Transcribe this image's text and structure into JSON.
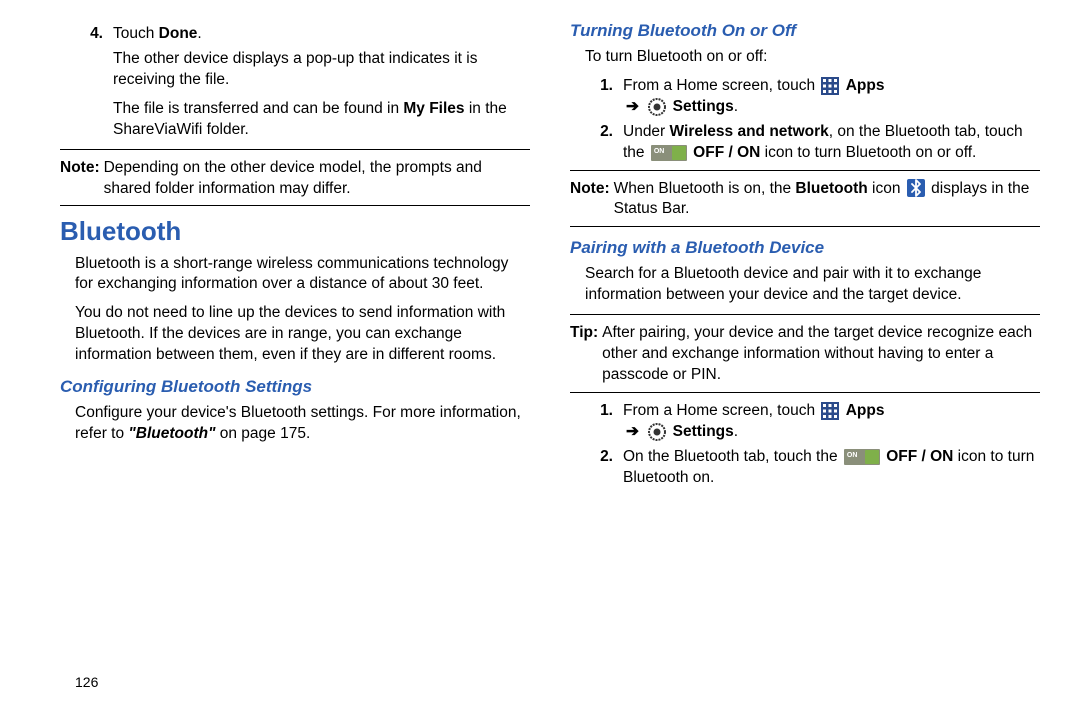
{
  "left": {
    "step4_num": "4.",
    "step4_a": "Touch ",
    "step4_b": "Done",
    "step4_c": ".",
    "step4_p1": "The other device displays a pop-up that indicates it is receiving the file.",
    "step4_p2a": "The file is transferred and can be found in ",
    "step4_p2b": "My Files",
    "step4_p2c": " in the ShareViaWifi folder.",
    "note_label": "Note:",
    "note_body": "Depending on the other device model, the prompts and shared folder information may differ.",
    "h1": "Bluetooth",
    "bt_p1": "Bluetooth is a short-range wireless communications technology for exchanging information over a distance of about 30 feet.",
    "bt_p2": "You do not need to line up the devices to send information with Bluetooth. If the devices are in range, you can exchange information between them, even if they are in different rooms.",
    "h2_cfg": "Configuring Bluetooth Settings",
    "cfg_p_a": "Configure your device's Bluetooth settings. For more information, refer to ",
    "cfg_p_b": "\"Bluetooth\" ",
    "cfg_p_c": " on page 175.",
    "pagenum": "126"
  },
  "right": {
    "h2_turn": "Turning Bluetooth On or Off",
    "turn_intro": "To turn Bluetooth on or off:",
    "s1_num": "1.",
    "s1_a": "From a Home screen, touch ",
    "s1_b": " Apps",
    "s1_c": " Settings",
    "s1_d": ".",
    "s2_num": "2.",
    "s2_a": "Under ",
    "s2_b": "Wireless and network",
    "s2_c": ", on the Bluetooth tab, touch the ",
    "s2_d": " OFF / ON",
    "s2_e": " icon to turn Bluetooth on or off.",
    "note_label": "Note:",
    "note_a": "When Bluetooth is on, the ",
    "note_b": "Bluetooth",
    "note_c": " icon ",
    "note_d": " displays in the Status Bar.",
    "h2_pair": "Pairing with a Bluetooth Device",
    "pair_p": "Search for a Bluetooth device and pair with it to exchange information between your device and the target device.",
    "tip_label": "Tip:",
    "tip_body": "After pairing, your device and the target device recognize each other and exchange information without having to enter a passcode or PIN.",
    "p1_num": "1.",
    "p1_a": "From a Home screen, touch ",
    "p1_b": " Apps",
    "p1_c": " Settings",
    "p1_d": ".",
    "p2_num": "2.",
    "p2_a": "On the Bluetooth tab, touch the ",
    "p2_b": " OFF / ON",
    "p2_c": " icon to turn Bluetooth on.",
    "arrow": "➔",
    "toggle_on": "ON"
  }
}
